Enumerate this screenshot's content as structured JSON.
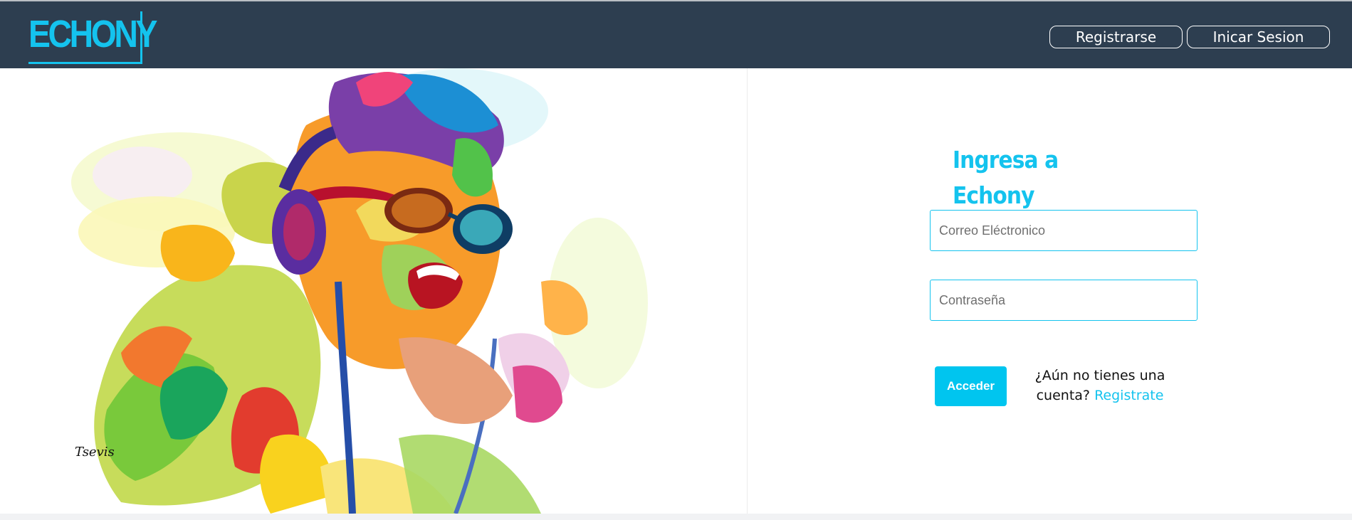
{
  "brand": {
    "logo_text": "ECHONY",
    "accent_color": "#14c3ee",
    "navbar_color": "#2d3e50"
  },
  "nav": {
    "register_label": "Registrarse",
    "login_label": "Inicar Sesion"
  },
  "login": {
    "title": "Ingresa a Echony",
    "email_placeholder": "Correo Eléctronico",
    "password_placeholder": "Contraseña",
    "submit_label": "Acceder",
    "signup_prompt_1": "¿Aún no tienes una",
    "signup_prompt_2": "cuenta?",
    "signup_link": "Registrate"
  },
  "hero": {
    "image_description_icon": "colorful-singer-illustration"
  }
}
